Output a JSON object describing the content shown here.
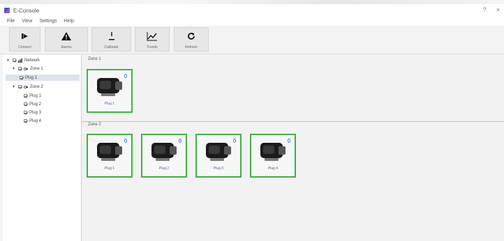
{
  "window": {
    "title": "E‑Console"
  },
  "menu": [
    "File",
    "View",
    "Settings",
    "Help"
  ],
  "toolbar": [
    {
      "label": "Connect",
      "icon": "connect-icon"
    },
    {
      "label": "Alarms",
      "icon": "warning-icon"
    },
    {
      "label": "Calibrate",
      "icon": "level-icon"
    },
    {
      "label": "Trends",
      "icon": "trend-icon"
    },
    {
      "label": "Refresh",
      "icon": "refresh-icon"
    }
  ],
  "tree": {
    "root": "Network",
    "groups": [
      {
        "label": "Zone 1",
        "items": [
          "Plug 1"
        ]
      },
      {
        "label": "Zone 2",
        "items": [
          "Plug 1",
          "Plug 2",
          "Plug 3",
          "Plug 4"
        ]
      }
    ]
  },
  "sections": [
    {
      "title": "Zone 1",
      "devices": [
        "Plug 1"
      ]
    },
    {
      "title": "Zone 2",
      "devices": [
        "Plug 1",
        "Plug 2",
        "Plug 3",
        "Plug 4"
      ]
    }
  ],
  "colors": {
    "card_border": "#3fb33f",
    "divider": "#f0b090",
    "badge": "#3d7ee6"
  }
}
